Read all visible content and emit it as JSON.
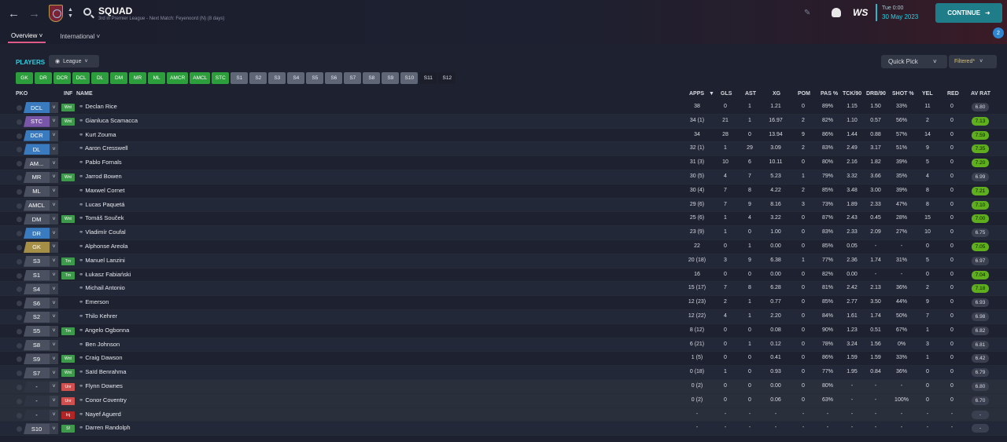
{
  "header": {
    "title": "SQUAD",
    "subtitle": "3rd in Premier League - Next Match: Feyenoord (N) (8 days)",
    "back_icon": "back-arrow-icon",
    "forward_icon": "forward-arrow-icon",
    "club_crest": "club-crest-icon",
    "search_icon": "search-icon",
    "tabs": [
      {
        "label": "Overview"
      },
      {
        "label": "International"
      }
    ],
    "time": "Tue 0:00",
    "date": "30 May 2023",
    "brand": "WS",
    "continue_label": "CONTINUE",
    "notif_count": "2"
  },
  "toolbar": {
    "players_label": "PLAYERS",
    "view_selector": "League",
    "quick_pick": "Quick Pick",
    "filtered": "Filtered*"
  },
  "position_buttons": [
    {
      "label": "GK",
      "kind": "g"
    },
    {
      "label": "DR",
      "kind": "g"
    },
    {
      "label": "DCR",
      "kind": "g"
    },
    {
      "label": "DCL",
      "kind": "g"
    },
    {
      "label": "DL",
      "kind": "g"
    },
    {
      "label": "DM",
      "kind": "g"
    },
    {
      "label": "MR",
      "kind": "g"
    },
    {
      "label": "ML",
      "kind": "g"
    },
    {
      "label": "AMCR",
      "kind": "g"
    },
    {
      "label": "AMCL",
      "kind": "g"
    },
    {
      "label": "STC",
      "kind": "g"
    },
    {
      "label": "S1",
      "kind": "s"
    },
    {
      "label": "S2",
      "kind": "s"
    },
    {
      "label": "S3",
      "kind": "s"
    },
    {
      "label": "S4",
      "kind": "s"
    },
    {
      "label": "S5",
      "kind": "s"
    },
    {
      "label": "S6",
      "kind": "s"
    },
    {
      "label": "S7",
      "kind": "s"
    },
    {
      "label": "S8",
      "kind": "s"
    },
    {
      "label": "S9",
      "kind": "s"
    },
    {
      "label": "S10",
      "kind": "s"
    },
    {
      "label": "S11",
      "kind": "d"
    },
    {
      "label": "S12",
      "kind": "d"
    }
  ],
  "columns": {
    "pko": "PKO",
    "inf": "INF",
    "name": "NAME",
    "apps": "APPS",
    "gls": "GLS",
    "ast": "AST",
    "xg": "XG",
    "pom": "POM",
    "pas": "PAS %",
    "tck": "TCK/90",
    "drb": "DRB/90",
    "shot": "SHOT %",
    "yel": "YEL",
    "red": "RED",
    "avrat": "AV RAT"
  },
  "players": [
    {
      "pos": "DCL",
      "posColor": "#3a7bc0",
      "inf": "Wnt",
      "infColor": "#3d9a4a",
      "name": "Declan Rice",
      "apps": "38",
      "gls": "0",
      "ast": "1",
      "xg": "1.21",
      "pom": "0",
      "pas": "89%",
      "tck": "1.15",
      "drb": "1.50",
      "shot": "33%",
      "yel": "11",
      "red": "0",
      "rat": "6.80",
      "ratColor": "#3b4050"
    },
    {
      "pos": "STC",
      "posColor": "#7a56a8",
      "inf": "Wnt",
      "infColor": "#3d9a4a",
      "name": "Gianluca Scamacca",
      "apps": "34 (1)",
      "gls": "21",
      "ast": "1",
      "xg": "16.97",
      "pom": "2",
      "pas": "82%",
      "tck": "1.10",
      "drb": "0.57",
      "shot": "56%",
      "yel": "2",
      "red": "0",
      "rat": "7.13",
      "ratColor": "#5fae1e"
    },
    {
      "pos": "DCR",
      "posColor": "#3a7bc0",
      "inf": "",
      "infColor": "",
      "name": "Kurt Zouma",
      "apps": "34",
      "gls": "28",
      "ast": "0",
      "xg": "13.94",
      "pom": "9",
      "pas": "86%",
      "tck": "1.44",
      "drb": "0.88",
      "shot": "57%",
      "yel": "14",
      "red": "0",
      "rat": "7.59",
      "ratColor": "#5fae1e"
    },
    {
      "pos": "DL",
      "posColor": "#3a7bc0",
      "inf": "",
      "infColor": "",
      "name": "Aaron Cresswell",
      "apps": "32 (1)",
      "gls": "1",
      "ast": "29",
      "xg": "3.09",
      "pom": "2",
      "pas": "83%",
      "tck": "2.49",
      "drb": "3.17",
      "shot": "51%",
      "yel": "9",
      "red": "0",
      "rat": "7.35",
      "ratColor": "#5fae1e"
    },
    {
      "pos": "AM...",
      "posColor": "#4a5060",
      "inf": "",
      "infColor": "",
      "name": "Pablo Fornals",
      "apps": "31 (3)",
      "gls": "10",
      "ast": "6",
      "xg": "10.11",
      "pom": "0",
      "pas": "80%",
      "tck": "2.16",
      "drb": "1.82",
      "shot": "39%",
      "yel": "5",
      "red": "0",
      "rat": "7.20",
      "ratColor": "#5fae1e"
    },
    {
      "pos": "MR",
      "posColor": "#4a5060",
      "inf": "Wnt",
      "infColor": "#3d9a4a",
      "name": "Jarrod Bowen",
      "apps": "30 (5)",
      "gls": "4",
      "ast": "7",
      "xg": "5.23",
      "pom": "1",
      "pas": "79%",
      "tck": "3.32",
      "drb": "3.66",
      "shot": "35%",
      "yel": "4",
      "red": "0",
      "rat": "6.99",
      "ratColor": "#3b4050"
    },
    {
      "pos": "ML",
      "posColor": "#4a5060",
      "inf": "",
      "infColor": "",
      "name": "Maxwel Cornet",
      "apps": "30 (4)",
      "gls": "7",
      "ast": "8",
      "xg": "4.22",
      "pom": "2",
      "pas": "85%",
      "tck": "3.48",
      "drb": "3.00",
      "shot": "39%",
      "yel": "8",
      "red": "0",
      "rat": "7.21",
      "ratColor": "#5fae1e"
    },
    {
      "pos": "AMCL",
      "posColor": "#4a5060",
      "inf": "",
      "infColor": "",
      "name": "Lucas Paquetá",
      "apps": "29 (6)",
      "gls": "7",
      "ast": "9",
      "xg": "8.16",
      "pom": "3",
      "pas": "73%",
      "tck": "1.89",
      "drb": "2.33",
      "shot": "47%",
      "yel": "8",
      "red": "0",
      "rat": "7.10",
      "ratColor": "#5fae1e"
    },
    {
      "pos": "DM",
      "posColor": "#4a5060",
      "inf": "Wnt",
      "infColor": "#3d9a4a",
      "name": "Tomáš Souček",
      "apps": "25 (6)",
      "gls": "1",
      "ast": "4",
      "xg": "3.22",
      "pom": "0",
      "pas": "87%",
      "tck": "2.43",
      "drb": "0.45",
      "shot": "28%",
      "yel": "15",
      "red": "0",
      "rat": "7.00",
      "ratColor": "#5fae1e"
    },
    {
      "pos": "DR",
      "posColor": "#3a7bc0",
      "inf": "",
      "infColor": "",
      "name": "Vladimír Coufal",
      "apps": "23 (9)",
      "gls": "1",
      "ast": "0",
      "xg": "1.00",
      "pom": "0",
      "pas": "83%",
      "tck": "2.33",
      "drb": "2.09",
      "shot": "27%",
      "yel": "10",
      "red": "0",
      "rat": "6.75",
      "ratColor": "#3b4050"
    },
    {
      "pos": "GK",
      "posColor": "#a58e45",
      "inf": "",
      "infColor": "",
      "name": "Alphonse Areola",
      "apps": "22",
      "gls": "0",
      "ast": "1",
      "xg": "0.00",
      "pom": "0",
      "pas": "85%",
      "tck": "0.05",
      "drb": "-",
      "shot": "-",
      "yel": "0",
      "red": "0",
      "rat": "7.05",
      "ratColor": "#5fae1e"
    },
    {
      "pos": "S3",
      "posColor": "#4a5060",
      "inf": "Tm",
      "infColor": "#3d9a4a",
      "name": "Manuel Lanzini",
      "apps": "20 (18)",
      "gls": "3",
      "ast": "9",
      "xg": "6.38",
      "pom": "1",
      "pas": "77%",
      "tck": "2.36",
      "drb": "1.74",
      "shot": "31%",
      "yel": "5",
      "red": "0",
      "rat": "6.97",
      "ratColor": "#3b4050"
    },
    {
      "pos": "S1",
      "posColor": "#4a5060",
      "inf": "Tm",
      "infColor": "#3d9a4a",
      "name": "Łukasz Fabiański",
      "apps": "16",
      "gls": "0",
      "ast": "0",
      "xg": "0.00",
      "pom": "0",
      "pas": "82%",
      "tck": "0.00",
      "drb": "-",
      "shot": "-",
      "yel": "0",
      "red": "0",
      "rat": "7.04",
      "ratColor": "#5fae1e"
    },
    {
      "pos": "S4",
      "posColor": "#4a5060",
      "inf": "",
      "infColor": "",
      "name": "Michail Antonio",
      "apps": "15 (17)",
      "gls": "7",
      "ast": "8",
      "xg": "6.28",
      "pom": "0",
      "pas": "81%",
      "tck": "2.42",
      "drb": "2.13",
      "shot": "36%",
      "yel": "2",
      "red": "0",
      "rat": "7.18",
      "ratColor": "#5fae1e"
    },
    {
      "pos": "S6",
      "posColor": "#4a5060",
      "inf": "",
      "infColor": "",
      "name": "Emerson",
      "apps": "12 (23)",
      "gls": "2",
      "ast": "1",
      "xg": "0.77",
      "pom": "0",
      "pas": "85%",
      "tck": "2.77",
      "drb": "3.50",
      "shot": "44%",
      "yel": "9",
      "red": "0",
      "rat": "6.93",
      "ratColor": "#3b4050"
    },
    {
      "pos": "S2",
      "posColor": "#4a5060",
      "inf": "",
      "infColor": "",
      "name": "Thilo Kehrer",
      "apps": "12 (22)",
      "gls": "4",
      "ast": "1",
      "xg": "2.20",
      "pom": "0",
      "pas": "84%",
      "tck": "1.61",
      "drb": "1.74",
      "shot": "50%",
      "yel": "7",
      "red": "0",
      "rat": "6.98",
      "ratColor": "#3b4050"
    },
    {
      "pos": "S5",
      "posColor": "#4a5060",
      "inf": "Tm",
      "infColor": "#3d9a4a",
      "name": "Angelo Ogbonna",
      "apps": "8 (12)",
      "gls": "0",
      "ast": "0",
      "xg": "0.08",
      "pom": "0",
      "pas": "90%",
      "tck": "1.23",
      "drb": "0.51",
      "shot": "67%",
      "yel": "1",
      "red": "0",
      "rat": "6.82",
      "ratColor": "#3b4050"
    },
    {
      "pos": "S8",
      "posColor": "#4a5060",
      "inf": "",
      "infColor": "",
      "name": "Ben Johnson",
      "apps": "6 (21)",
      "gls": "0",
      "ast": "1",
      "xg": "0.12",
      "pom": "0",
      "pas": "78%",
      "tck": "3.24",
      "drb": "1.56",
      "shot": "0%",
      "yel": "3",
      "red": "0",
      "rat": "6.81",
      "ratColor": "#3b4050"
    },
    {
      "pos": "S9",
      "posColor": "#4a5060",
      "inf": "Wnt",
      "infColor": "#3d9a4a",
      "name": "Craig Dawson",
      "apps": "1 (5)",
      "gls": "0",
      "ast": "0",
      "xg": "0.41",
      "pom": "0",
      "pas": "86%",
      "tck": "1.59",
      "drb": "1.59",
      "shot": "33%",
      "yel": "1",
      "red": "0",
      "rat": "6.42",
      "ratColor": "#3b4050"
    },
    {
      "pos": "S7",
      "posColor": "#4a5060",
      "inf": "Wnt",
      "infColor": "#3d9a4a",
      "name": "Saïd Benrahma",
      "apps": "0 (18)",
      "gls": "1",
      "ast": "0",
      "xg": "0.93",
      "pom": "0",
      "pas": "77%",
      "tck": "1.95",
      "drb": "0.84",
      "shot": "36%",
      "yel": "0",
      "red": "0",
      "rat": "6.79",
      "ratColor": "#3b4050"
    },
    {
      "pos": "-",
      "posColor": "#2f3442",
      "inf": "Unr",
      "infColor": "#d0504f",
      "name": "Flynn Downes",
      "apps": "0 (2)",
      "gls": "0",
      "ast": "0",
      "xg": "0.00",
      "pom": "0",
      "pas": "80%",
      "tck": "-",
      "drb": "-",
      "shot": "-",
      "yel": "0",
      "red": "0",
      "rat": "6.80",
      "ratColor": "#3b4050"
    },
    {
      "pos": "-",
      "posColor": "#2f3442",
      "inf": "Unr",
      "infColor": "#d0504f",
      "name": "Conor Coventry",
      "apps": "0 (2)",
      "gls": "0",
      "ast": "0",
      "xg": "0.06",
      "pom": "0",
      "pas": "63%",
      "tck": "-",
      "drb": "-",
      "shot": "100%",
      "yel": "0",
      "red": "0",
      "rat": "6.70",
      "ratColor": "#3b4050"
    },
    {
      "pos": "-",
      "posColor": "#2f3442",
      "inf": "Inj",
      "infColor": "#b32525",
      "name": "Nayef Aguerd",
      "apps": "-",
      "gls": "-",
      "ast": "-",
      "xg": "-",
      "pom": "-",
      "pas": "-",
      "tck": "-",
      "drb": "-",
      "shot": "-",
      "yel": "-",
      "red": "-",
      "rat": "-",
      "ratColor": "#3b4050"
    },
    {
      "pos": "S10",
      "posColor": "#4a5060",
      "inf": "Sf",
      "infColor": "#3d9a4a",
      "name": "Darren Randolph",
      "apps": "-",
      "gls": "-",
      "ast": "-",
      "xg": "-",
      "pom": "-",
      "pas": "-",
      "tck": "-",
      "drb": "-",
      "shot": "-",
      "yel": "-",
      "red": "-",
      "rat": "-",
      "ratColor": "#3b4050"
    }
  ]
}
